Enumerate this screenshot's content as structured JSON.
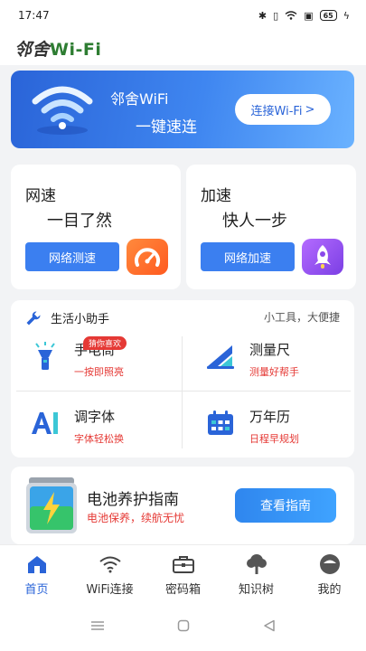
{
  "status_bar": {
    "time": "17:47",
    "battery": "65"
  },
  "header": {
    "logo_zh": "邻舍",
    "logo_en": "Wi-Fi"
  },
  "banner": {
    "title": "邻舍WiFi",
    "subtitle": "一键速连",
    "button_label": "连接Wi-Fi",
    "button_chevron": ">"
  },
  "speed_cards": [
    {
      "title": "网速",
      "subtitle": "一目了然",
      "button_label": "网络测速",
      "icon": "speedometer-icon"
    },
    {
      "title": "加速",
      "subtitle": "快人一步",
      "button_label": "网络加速",
      "icon": "rocket-icon"
    }
  ],
  "helper": {
    "title": "生活小助手",
    "tagline": "小工具，大便捷",
    "tools": [
      {
        "name": "手电筒",
        "desc": "一按即照亮",
        "badge": "猜你喜欢",
        "icon": "flashlight-icon"
      },
      {
        "name": "测量尺",
        "desc": "测量好帮手",
        "icon": "ruler-icon"
      },
      {
        "name": "调字体",
        "desc": "字体轻松换",
        "icon": "font-icon"
      },
      {
        "name": "万年历",
        "desc": "日程早规划",
        "icon": "calendar-icon"
      }
    ]
  },
  "battery_card": {
    "title": "电池养护指南",
    "subtitle": "电池保养，续航无忧",
    "button_label": "查看指南"
  },
  "tabs": [
    {
      "label": "首页",
      "icon": "home-icon",
      "active": true
    },
    {
      "label": "WiFi连接",
      "icon": "wifi-icon",
      "active": false
    },
    {
      "label": "密码箱",
      "icon": "briefcase-icon",
      "active": false
    },
    {
      "label": "知识树",
      "icon": "tree-icon",
      "active": false
    },
    {
      "label": "我的",
      "icon": "profile-icon",
      "active": false
    }
  ],
  "colors": {
    "primary": "#3b7ff0",
    "accent_red": "#e53935",
    "logo_green": "#2e7d32"
  }
}
